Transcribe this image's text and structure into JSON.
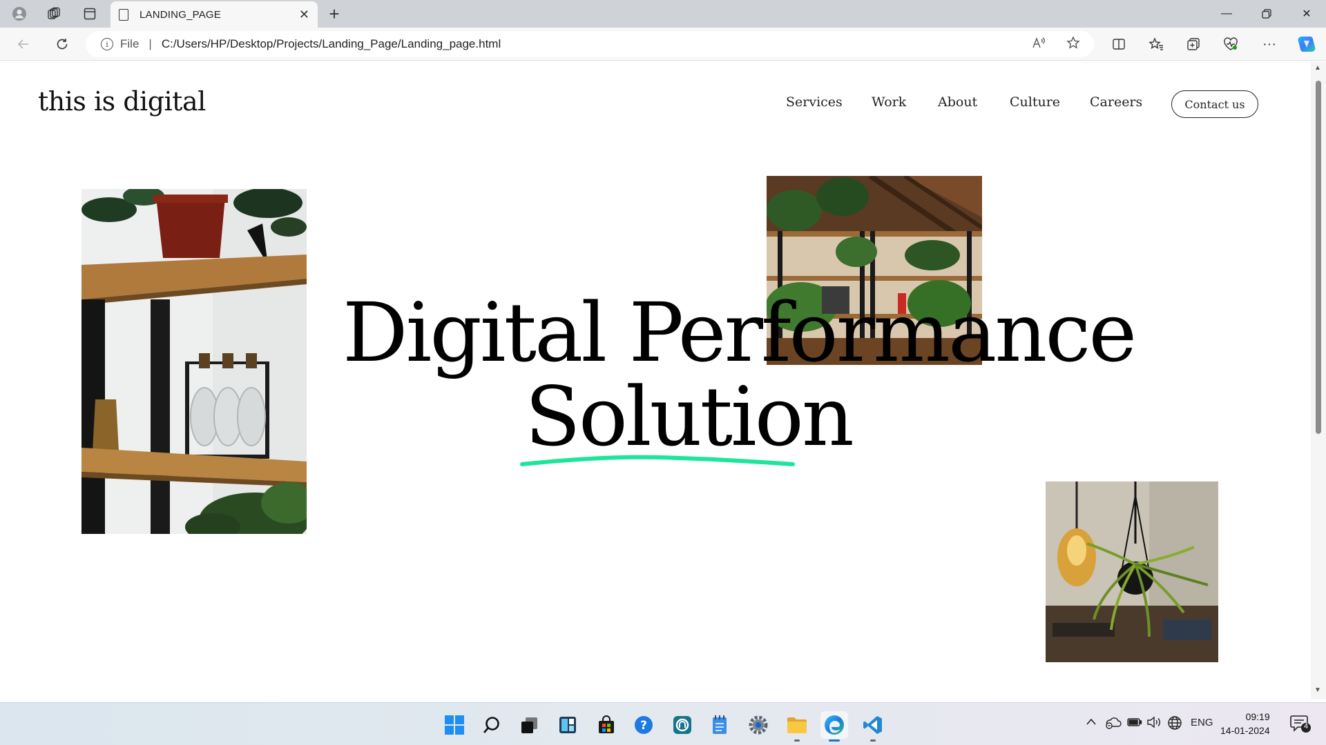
{
  "browser": {
    "tab_title": "LANDING_PAGE",
    "address_scheme": "File",
    "address_url": "C:/Users/HP/Desktop/Projects/Landing_Page/Landing_page.html"
  },
  "page": {
    "brand": "this is digital",
    "nav": [
      "Services",
      "Work",
      "About",
      "Culture",
      "Careers"
    ],
    "contact_label": "Contact us",
    "hero_line1": "Digital Performance",
    "hero_line2": "Solution",
    "accent_color": "#1de59a"
  },
  "taskbar": {
    "language": "ENG",
    "time": "09:19",
    "date": "14-01-2024",
    "notification_count": "4"
  }
}
